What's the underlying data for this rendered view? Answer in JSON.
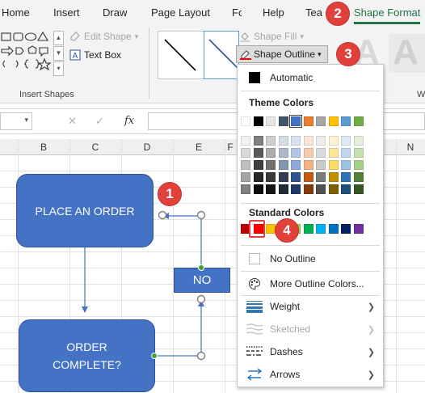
{
  "ribbon_tabs": [
    "Home",
    "Insert",
    "Draw",
    "Page Layout",
    "Fo",
    "Help",
    "Tea",
    "Shape Format"
  ],
  "ribbon": {
    "edit_shape": "Edit Shape",
    "text_box": "Text Box",
    "insert_shapes_label": "Insert Shapes",
    "shape_fill": "Shape Fill",
    "shape_outline": "Shape Outline",
    "wordart_letter": "A",
    "cut_group_label": "W"
  },
  "formula_bar": {
    "cancel_symbol": "✕",
    "enter_symbol": "✓",
    "fx_label": "fx"
  },
  "columns": [
    "B",
    "C",
    "D",
    "E",
    "F",
    "N"
  ],
  "flowchart": {
    "place_order": "PLACE AN ORDER",
    "no": "NO",
    "order_complete_line1": "ORDER",
    "order_complete_line2": "COMPLETE?"
  },
  "steps": [
    "1",
    "2",
    "3",
    "4"
  ],
  "dropdown": {
    "automatic": "Automatic",
    "theme_colors_heading": "Theme Colors",
    "standard_colors_heading": "Standard Colors",
    "no_outline": "No Outline",
    "more_colors": "More Outline Colors...",
    "weight": "Weight",
    "sketched": "Sketched",
    "dashes": "Dashes",
    "arrows": "Arrows"
  },
  "theme_top_row": [
    "#ffffff",
    "#000000",
    "#e7e6e6",
    "#44546a",
    "#4472c4",
    "#ed7d31",
    "#a5a5a5",
    "#ffc000",
    "#5b9bd5",
    "#70ad47"
  ],
  "theme_shades": [
    [
      "#f2f2f2",
      "#7f7f7f",
      "#d0cece",
      "#d6dce4",
      "#d9e2f3",
      "#fbe5d5",
      "#ededed",
      "#fff2cc",
      "#deebf6",
      "#e2efd9"
    ],
    [
      "#d8d8d8",
      "#595959",
      "#aeabab",
      "#adb9ca",
      "#b4c6e7",
      "#f7cbac",
      "#dbdbdb",
      "#fee599",
      "#bdd7ee",
      "#c5e0b3"
    ],
    [
      "#bfbfbf",
      "#3f3f3f",
      "#757070",
      "#8496b0",
      "#8eaadb",
      "#f4b183",
      "#c9c9c9",
      "#ffd965",
      "#9cc3e5",
      "#a8d08d"
    ],
    [
      "#a5a5a5",
      "#262626",
      "#3a3838",
      "#323f4f",
      "#2f5496",
      "#c55a11",
      "#7b7b7b",
      "#bf9000",
      "#2e75b5",
      "#538135"
    ],
    [
      "#7f7f7f",
      "#0c0c0c",
      "#171616",
      "#222a35",
      "#1f3864",
      "#833c0b",
      "#525252",
      "#7f6000",
      "#1e4e79",
      "#375623"
    ]
  ],
  "standard_colors": [
    "#c00000",
    "#ff0000",
    "#ffc000",
    "#ffff00",
    "#92d050",
    "#00b050",
    "#00b0f0",
    "#0070c0",
    "#002060",
    "#7030a0"
  ],
  "accent_colors": {
    "excel_green": "#217346",
    "flow_blue": "#4472c4",
    "badge_red": "#e2413b",
    "connector_blue": "#4472c4",
    "handle_green": "#3aa535"
  },
  "icons": [
    "shape-outline-icon",
    "shape-fill-icon",
    "edit-shape-icon",
    "text-box-icon",
    "weight-icon",
    "sketched-icon",
    "dashes-icon",
    "arrows-icon",
    "palette-icon"
  ]
}
